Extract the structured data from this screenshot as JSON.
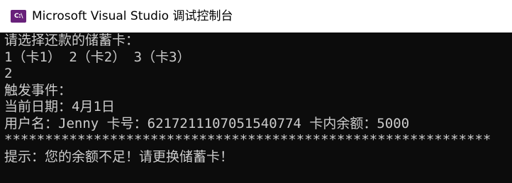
{
  "window": {
    "icon_text": "C:\\",
    "title": "Microsoft Visual Studio 调试控制台"
  },
  "console": {
    "lines": [
      "请选择还款的储蓄卡：",
      "1（卡1） 2（卡2） 3（卡3）",
      "2",
      "触发事件：",
      "当前日期：4月1日",
      "用户名：Jenny 卡号：6217211107051540774 卡内余额：5000",
      "************************************************************",
      "提示：您的余额不足！请更换储蓄卡！"
    ]
  },
  "colors": {
    "console_bg": "#0c0c0c",
    "console_fg": "#cccccc",
    "titlebar_bg": "#ffffff",
    "icon_bg": "#68217a"
  }
}
